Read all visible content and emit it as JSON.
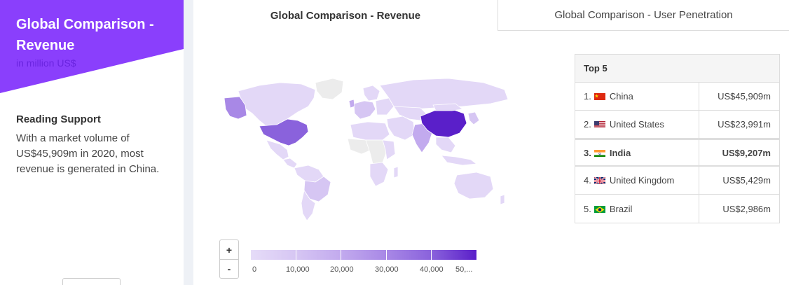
{
  "sidebar": {
    "title": "Global Comparison - Revenue",
    "subtitle": "in million US$",
    "reading_title": "Reading Support",
    "reading_text": "With a market volume of US$45,909m in 2020, most revenue is generated in China."
  },
  "tabs": [
    {
      "label": "Global Comparison - Revenue",
      "active": true
    },
    {
      "label": "Global Comparison - User Penetration",
      "active": false
    }
  ],
  "map": {
    "zoom_in_label": "+",
    "zoom_out_label": "-",
    "legend_ticks": [
      "0",
      "10,000",
      "20,000",
      "30,000",
      "40,000",
      "50,..."
    ],
    "legend_colors": [
      "#e6dcf8",
      "#d6c6f3",
      "#c2aaee",
      "#a888e6",
      "#8a62dc",
      "#5a1fc9"
    ]
  },
  "top5": {
    "title": "Top 5",
    "rows": [
      {
        "rank": "1.",
        "flag": "cn-flag-icon",
        "country": "China",
        "value": "US$45,909m",
        "highlight": false
      },
      {
        "rank": "2.",
        "flag": "us-flag-icon",
        "country": "United States",
        "value": "US$23,991m",
        "highlight": false
      },
      {
        "rank": "3.",
        "flag": "in-flag-icon",
        "country": "India",
        "value": "US$9,207m",
        "highlight": true
      },
      {
        "rank": "4.",
        "flag": "uk-flag-icon",
        "country": "United Kingdom",
        "value": "US$5,429m",
        "highlight": false
      },
      {
        "rank": "5.",
        "flag": "br-flag-icon",
        "country": "Brazil",
        "value": "US$2,986m",
        "highlight": false
      }
    ]
  },
  "colors": {
    "accent": "#8a3ffc",
    "subtitle": "#6a24e0",
    "china": "#5a1fc9",
    "us": "#8a62dc",
    "light_region": "#e3d8f7",
    "no_data": "#f2f2f2"
  }
}
